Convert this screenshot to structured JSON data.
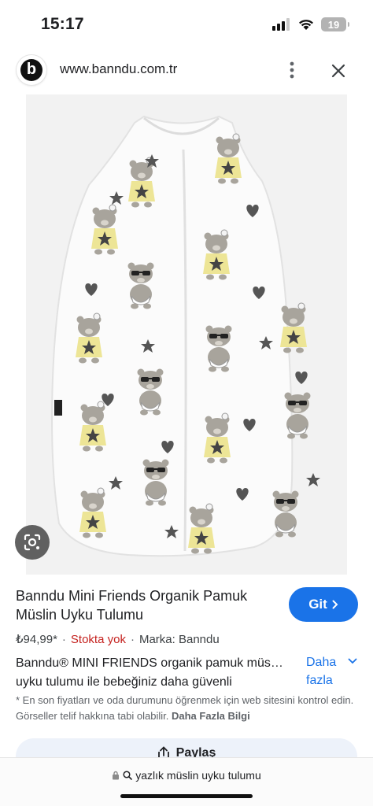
{
  "status_bar": {
    "time": "15:17",
    "battery": "19",
    "icons": [
      "signal-icon",
      "wifi-icon",
      "battery-icon"
    ]
  },
  "browser": {
    "site_logo_letter": "b",
    "url": "www.banndu.com.tr",
    "icons": [
      "more-vert-icon",
      "close-icon"
    ]
  },
  "product": {
    "title": "Banndu Mini Friends Organik Pamuk Müslin Uyku Tulumu",
    "go_label": "Git",
    "price": "₺94,99*",
    "stock": "Stokta yok",
    "brand": "Marka: Banndu",
    "desc_line1": "Banndu® MINI FRIENDS organik pamuk müs…",
    "desc_line2": "uyku tulumu ile bebeğiniz daha güvenli",
    "more_label_1": "Daha",
    "more_label_2": "fazla",
    "disclaimer": "* En son fiyatları ve oda durumunu öğrenmek için web sitesini kontrol edin. Görseller telif hakkına tabi olabilir.",
    "disclaimer_link": "Daha Fazla Bilgi",
    "share_label": "Paylaş"
  },
  "bottom_bar": {
    "query": "yazlık müslin uyku tulumu",
    "icons": [
      "lock-icon",
      "search-icon"
    ]
  },
  "colors": {
    "accent": "#1a73e8",
    "out_of_stock": "#c5221f",
    "image_background": "#f2f2f2",
    "bear_fill": "#a8a49c",
    "dress_fill": "#ede596",
    "print_dark": "#555555"
  }
}
